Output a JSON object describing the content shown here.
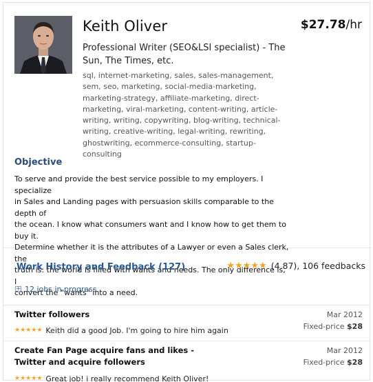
{
  "profile": {
    "name": "Keith Oliver",
    "rate": "$27.78",
    "rate_unit": "/hr",
    "headline": "Professional Writer (SEO&LSI specialist) - The Sun, The Times, etc.",
    "skills": "sql, internet-marketing, sales, sales-management, sem, seo, marketing, social-media-marketing, marketing-strategy, affiliate-marketing, direct-marketing, viral-marketing, content-writing, article-writing, writing, copywriting, blog-writing, technical-writing, creative-writing, legal-writing, rewriting, ghostwriting, ecommerce-consulting, startup-consulting"
  },
  "objective": {
    "title": "Objective",
    "lines": [
      "To serve and provide the best service possible to my employers. I specialize",
      "in Sales and Landing pages with persuasion skills comparable to the depth of",
      "the ocean.  I know what consumers want and I know how to get them to buy it.",
      "Determine whether it is the attributes of a Lawyer or even a Sales clerk, the",
      "truth is: the world is filled with wants and needs. The only difference is, I",
      "convert the \"wants\" into a need."
    ]
  },
  "work_history": {
    "title": "Work History and Feedback (127)",
    "rating": "(4.87), 106 feedbacks",
    "stars": 5,
    "in_progress": "12 jobs in progress",
    "jobs": [
      {
        "title": "Twitter followers",
        "date": "Mar 2012",
        "price_label": "Fixed-price",
        "price": "$28",
        "feedback": "Keith did a good Job. I'm going to hire him again",
        "stars": 5
      },
      {
        "title": "Create Fan Page acquire fans and likes - Twitter and acquire followers",
        "date": "Mar 2012",
        "price_label": "Fixed-price",
        "price": "$28",
        "feedback": "Great job! i really recommend Keith Oliver!",
        "stars": 5
      }
    ]
  },
  "colors": {
    "link_blue": "#2a5a8e",
    "heading_blue": "#2a4b7a",
    "star_orange": "#f2a41e"
  },
  "icons": {
    "expand": "plus-square-icon",
    "rating": "star-icon"
  }
}
